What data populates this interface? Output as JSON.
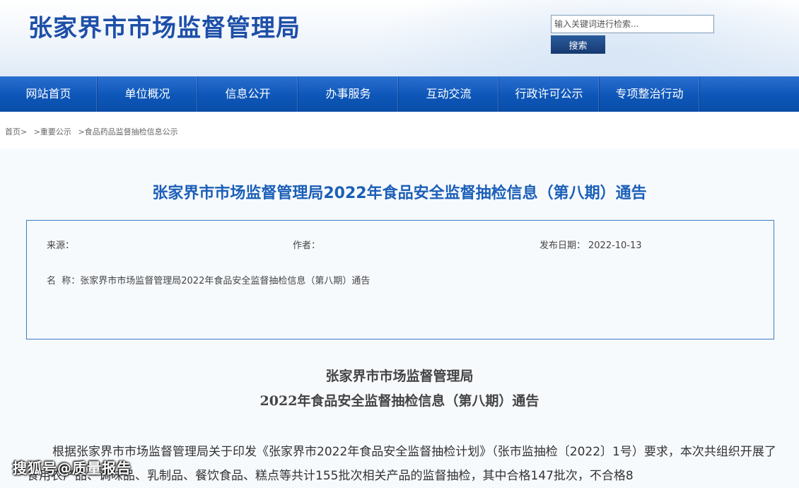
{
  "header": {
    "site_title": "张家界市市场监督管理局",
    "search_placeholder": "输入关键词进行检索...",
    "search_button": "搜索"
  },
  "nav": {
    "items": [
      "网站首页",
      "单位概况",
      "信息公开",
      "办事服务",
      "互动交流",
      "行政许可公示",
      "专项整治行动"
    ]
  },
  "breadcrumb": [
    "首页>",
    ">重要公示",
    ">食品药品监督抽检信息公示"
  ],
  "article": {
    "title": "张家界市市场监督管理局2022年食品安全监督抽检信息（第八期）通告",
    "meta": {
      "source_label": "来源：",
      "author_label": "作者：",
      "date_label": "发布日期：",
      "date_value": "2022-10-13",
      "name_label": "名  称：",
      "name_value": "张家界市市场监督管理局2022年食品安全监督抽检信息（第八期）通告"
    },
    "heading_line1": "张家界市市场监督管理局",
    "heading_line2": "2022年食品安全监督抽检信息（第八期）通告",
    "body": "根据张家界市市场监督管理局关于印发《张家界市2022年食品安全监督抽检计划》（张市监抽检〔2022〕1号）要求，本次共组织开展了食用农产品、调味品、乳制品、餐饮食品、糕点等共计155批次相关产品的监督抽检，其中合格147批次，不合格8"
  },
  "watermark": "搜狐号@质量报告"
}
